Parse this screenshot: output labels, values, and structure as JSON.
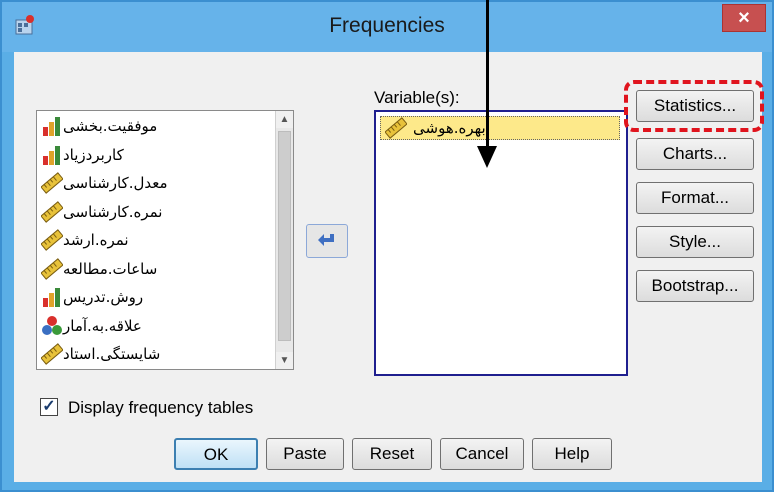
{
  "window": {
    "title": "Frequencies",
    "close_label": "×"
  },
  "source_variables": [
    {
      "label": "موفقیت.بخشی",
      "icon": "bar-chart-icon"
    },
    {
      "label": "کاربردزیاد",
      "icon": "bar-chart-icon"
    },
    {
      "label": "معدل.کارشناسی",
      "icon": "ruler-icon"
    },
    {
      "label": "نمره.کارشناسی",
      "icon": "ruler-icon"
    },
    {
      "label": "نمره.ارشد",
      "icon": "ruler-icon"
    },
    {
      "label": "ساعات.مطالعه",
      "icon": "ruler-icon"
    },
    {
      "label": "روش.تدریس",
      "icon": "bar-chart-icon"
    },
    {
      "label": "علاقه.به.آمار",
      "icon": "nominal-circles-icon"
    },
    {
      "label": "شایستگی.استاد",
      "icon": "ruler-icon"
    }
  ],
  "variables_panel": {
    "label": "Variable(s):",
    "items": [
      {
        "label": "بهره.هوشی",
        "icon": "ruler-icon"
      }
    ]
  },
  "side_buttons": {
    "statistics": "Statistics...",
    "charts": "Charts...",
    "format": "Format...",
    "style": "Style...",
    "bootstrap": "Bootstrap..."
  },
  "display_frequency_tables": {
    "label": "Display frequency tables",
    "checked": true
  },
  "bottom_buttons": {
    "ok": "OK",
    "paste": "Paste",
    "reset": "Reset",
    "cancel": "Cancel",
    "help": "Help"
  }
}
